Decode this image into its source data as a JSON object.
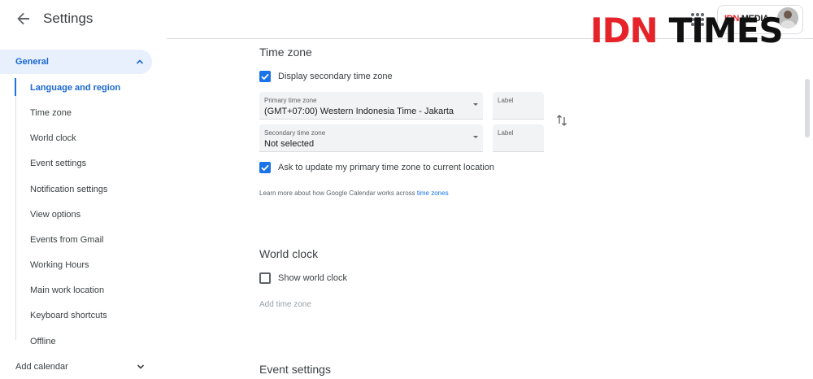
{
  "header": {
    "title": "Settings",
    "org_badge_red": "IDN",
    "org_badge_text": " MEDIA"
  },
  "watermark": {
    "part1": "IDN",
    "part2": "TIMES"
  },
  "sidebar": {
    "general": "General",
    "items": [
      {
        "label": "Language and region",
        "active": true
      },
      {
        "label": "Time zone"
      },
      {
        "label": "World clock"
      },
      {
        "label": "Event settings"
      },
      {
        "label": "Notification settings"
      },
      {
        "label": "View options"
      },
      {
        "label": "Events from Gmail"
      },
      {
        "label": "Working Hours"
      },
      {
        "label": "Main work location"
      },
      {
        "label": "Keyboard shortcuts"
      },
      {
        "label": "Offline"
      }
    ],
    "add_calendar": "Add calendar"
  },
  "time_zone": {
    "title": "Time zone",
    "display_secondary": {
      "label": "Display secondary time zone",
      "checked": true
    },
    "primary": {
      "caption": "Primary time zone",
      "value": "(GMT+07:00) Western Indonesia Time - Jakarta"
    },
    "primary_label_caption": "Label",
    "secondary": {
      "caption": "Secondary time zone",
      "value": "Not selected"
    },
    "secondary_label_caption": "Label",
    "ask_update": {
      "label": "Ask to update my primary time zone to current location",
      "checked": true
    },
    "learn_more_text": "Learn more about how Google Calendar works across ",
    "learn_more_link": "time zones"
  },
  "world_clock": {
    "title": "World clock",
    "show": {
      "label": "Show world clock",
      "checked": false
    },
    "add_time_zone": "Add time zone"
  },
  "event_settings": {
    "title": "Event settings"
  },
  "colors": {
    "accent": "#1a73e8",
    "active_nav_bg": "#e8f0fe",
    "brand_red": "#e52329"
  }
}
